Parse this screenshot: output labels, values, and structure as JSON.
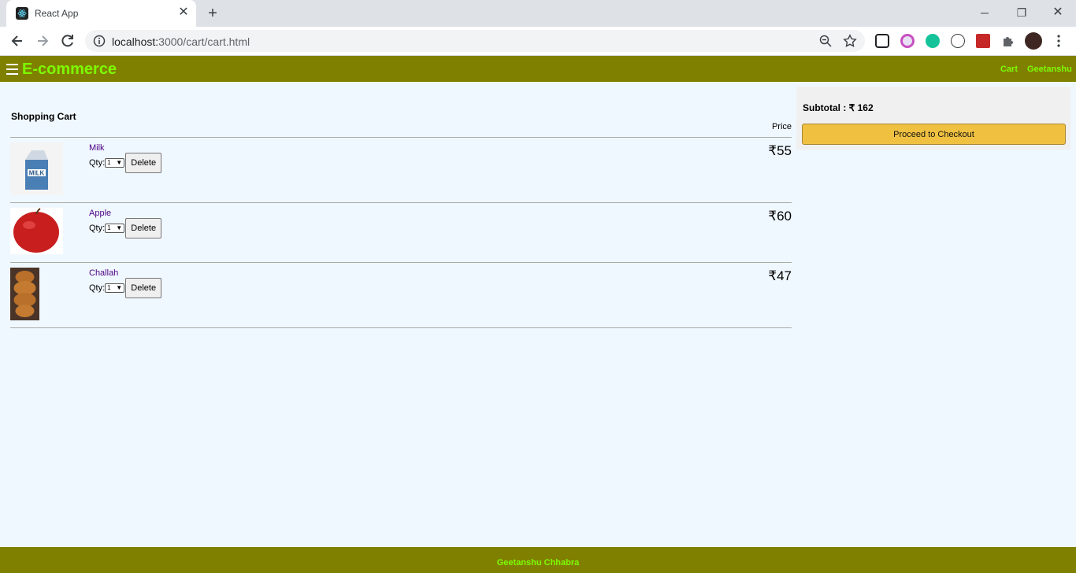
{
  "browser": {
    "tab_title": "React App",
    "url_host": "localhost:",
    "url_rest": "3000/cart/cart.html",
    "icons": [
      "react-favicon",
      "close-icon",
      "plus-icon",
      "minimize-icon",
      "restore-icon",
      "close-window-icon",
      "back-arrow-icon",
      "forward-arrow-icon",
      "reload-icon",
      "info-icon",
      "zoom-icon",
      "star-icon",
      "extension-icon",
      "puzzle-icon",
      "profile-avatar",
      "kebab-menu-icon"
    ]
  },
  "header": {
    "brand": "E-commerce",
    "links": [
      "Cart",
      "Geetanshu"
    ],
    "bg_color": "#808000",
    "accent_color": "#7cfc00"
  },
  "cart": {
    "title": "Shopping Cart",
    "price_header": "Price",
    "qty_label": "Qty:",
    "delete_label": "Delete",
    "items": [
      {
        "name": "Milk",
        "qty": "1",
        "price": "₹55"
      },
      {
        "name": "Apple",
        "qty": "1",
        "price": "₹60"
      },
      {
        "name": "Challah",
        "qty": "1",
        "price": "₹47"
      }
    ]
  },
  "summary": {
    "subtotal": "Subtotal : ₹ 162",
    "checkout_label": "Proceed to Checkout"
  },
  "footer": {
    "text": "Geetanshu Chhabra"
  }
}
